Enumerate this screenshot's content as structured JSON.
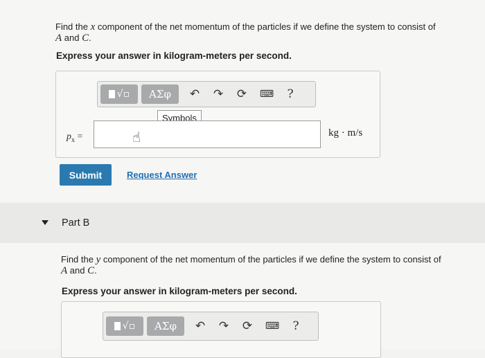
{
  "part_a": {
    "question_pre": "Find the ",
    "var_x": "x",
    "question_mid": " component of the net momentum of the particles if we define the system to consist of",
    "var_a": "A",
    "and": " and ",
    "var_c": "C",
    "period": ".",
    "instruction": "Express your answer in kilogram-meters per second.",
    "toolbar": {
      "greek_label": "ΑΣφ",
      "tooltip": "Symbols",
      "help": "?"
    },
    "answer_label_var": "p",
    "answer_label_sub": "x",
    "answer_label_eq": " =",
    "input_value": "",
    "units": "kg · m/s",
    "submit_label": "Submit",
    "request_label": "Request Answer"
  },
  "part_b": {
    "title": "Part B",
    "question_pre": "Find the ",
    "var_y": "y",
    "question_mid": " component of the net momentum of the particles if we define the system to consist of",
    "var_a": "A",
    "and": " and ",
    "var_c": "C",
    "period": ".",
    "instruction": "Express your answer in kilogram-meters per second.",
    "toolbar": {
      "greek_label": "ΑΣφ",
      "help": "?"
    }
  }
}
